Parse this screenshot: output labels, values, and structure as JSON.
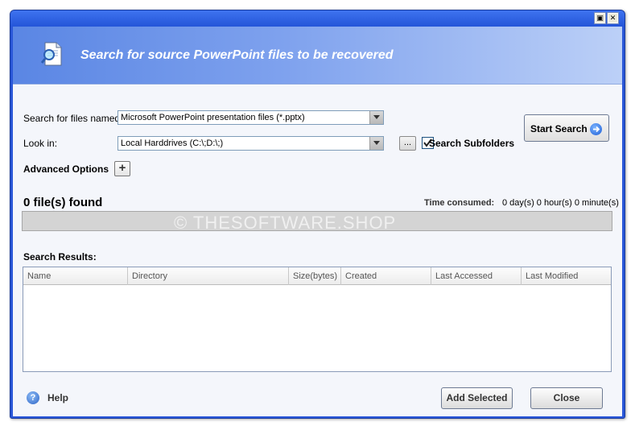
{
  "header": {
    "title": "Search for source PowerPoint files to be recovered"
  },
  "form": {
    "search_files_label": "Search for files named:",
    "search_files_value": "Microsoft PowerPoint presentation files (*.pptx)",
    "look_in_label": "Look in:",
    "look_in_value": "Local Harddrives (C:\\;D:\\;)",
    "browse_label": "...",
    "search_subfolders_label": "Search Subfolders",
    "search_subfolders_checked": true,
    "advanced_options_label": "Advanced Options",
    "advanced_toggle": "+",
    "start_search_label": "Start Search"
  },
  "status": {
    "files_found": "0 file(s) found",
    "time_consumed_label": "Time consumed:",
    "time_consumed_value": "0 day(s) 0 hour(s) 0 minute(s)",
    "progress": 0,
    "watermark": "© THESOFTWARE.SHOP"
  },
  "results": {
    "label": "Search Results:",
    "columns": [
      "Name",
      "Directory",
      "Size(bytes)",
      "Created",
      "Last Accessed",
      "Last Modified"
    ],
    "rows": []
  },
  "footer": {
    "help_label": "Help",
    "add_selected_label": "Add Selected",
    "close_label": "Close"
  },
  "colors": {
    "title_bar": "#2455d8",
    "header_gradient_start": "#5a86e4",
    "header_gradient_end": "#bcd0f7",
    "panel_background": "#f4f6fb"
  }
}
